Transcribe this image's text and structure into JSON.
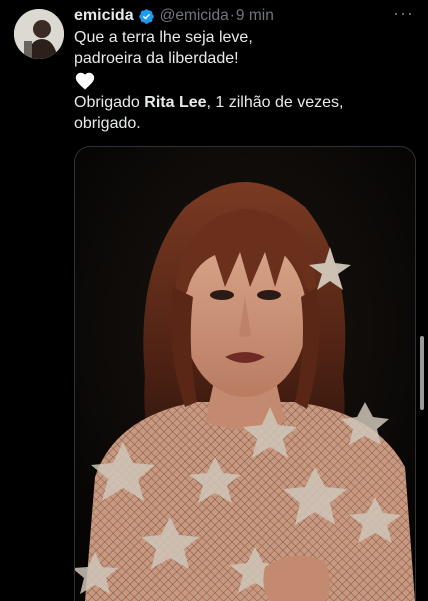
{
  "tweet": {
    "display_name": "emicida",
    "handle": "@emicida",
    "separator": "·",
    "time": "9 min",
    "more_label": "···",
    "text": {
      "line1": "Que a terra lhe seja leve,",
      "line2": "padroeira da liberdade!",
      "emoji": "🤍",
      "line4_pre": "Obrigado ",
      "line4_bold": "Rita Lee",
      "line4_post": ", 1 zilhão de vezes,",
      "line5": "obrigado."
    }
  },
  "colors": {
    "background": "#000000",
    "text_primary": "#e7e9ea",
    "text_secondary": "#71767b",
    "verified_blue": "#1d9bf0"
  },
  "icons": {
    "verified": "verified-badge-icon",
    "more": "more-options-icon",
    "heart": "white-heart-icon"
  }
}
